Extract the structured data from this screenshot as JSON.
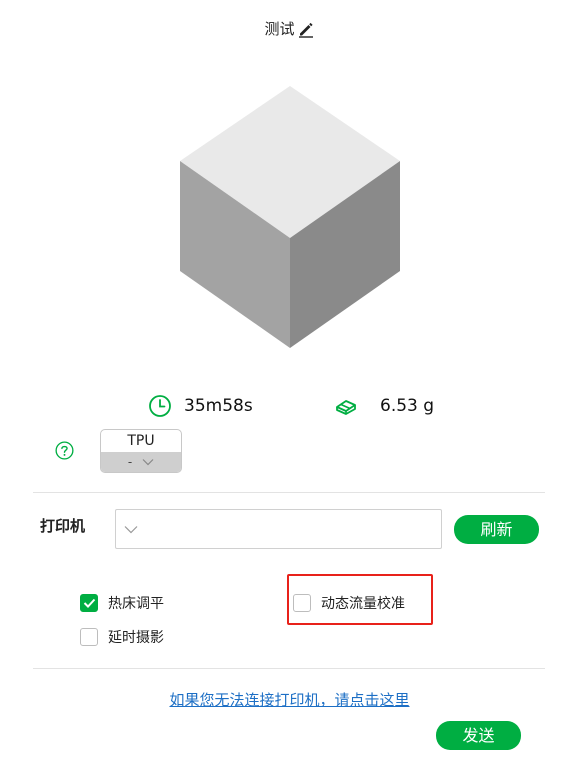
{
  "title": "测试",
  "stats": {
    "time": "35m58s",
    "weight": "6.53 g"
  },
  "filament": {
    "name": "TPU",
    "color_value": "-"
  },
  "printer": {
    "label": "打印机",
    "selected": "",
    "refresh_label": "刷新"
  },
  "options": {
    "bed_leveling": {
      "label": "热床调平",
      "checked": true
    },
    "timelapse": {
      "label": "延时摄影",
      "checked": false
    },
    "flow_calibration": {
      "label": "动态流量校准",
      "checked": false
    }
  },
  "help_link": "如果您无法连接打印机，请点击这里",
  "send_label": "发送",
  "colors": {
    "accent": "#00ae42",
    "highlight": "#e8211a",
    "link": "#1d6fc5"
  },
  "icons": {
    "edit": "pencil-icon",
    "clock": "clock-icon",
    "weight": "filament-spool-icon",
    "help": "help-icon",
    "dropdown": "chevron-down-icon",
    "check": "check-icon"
  }
}
